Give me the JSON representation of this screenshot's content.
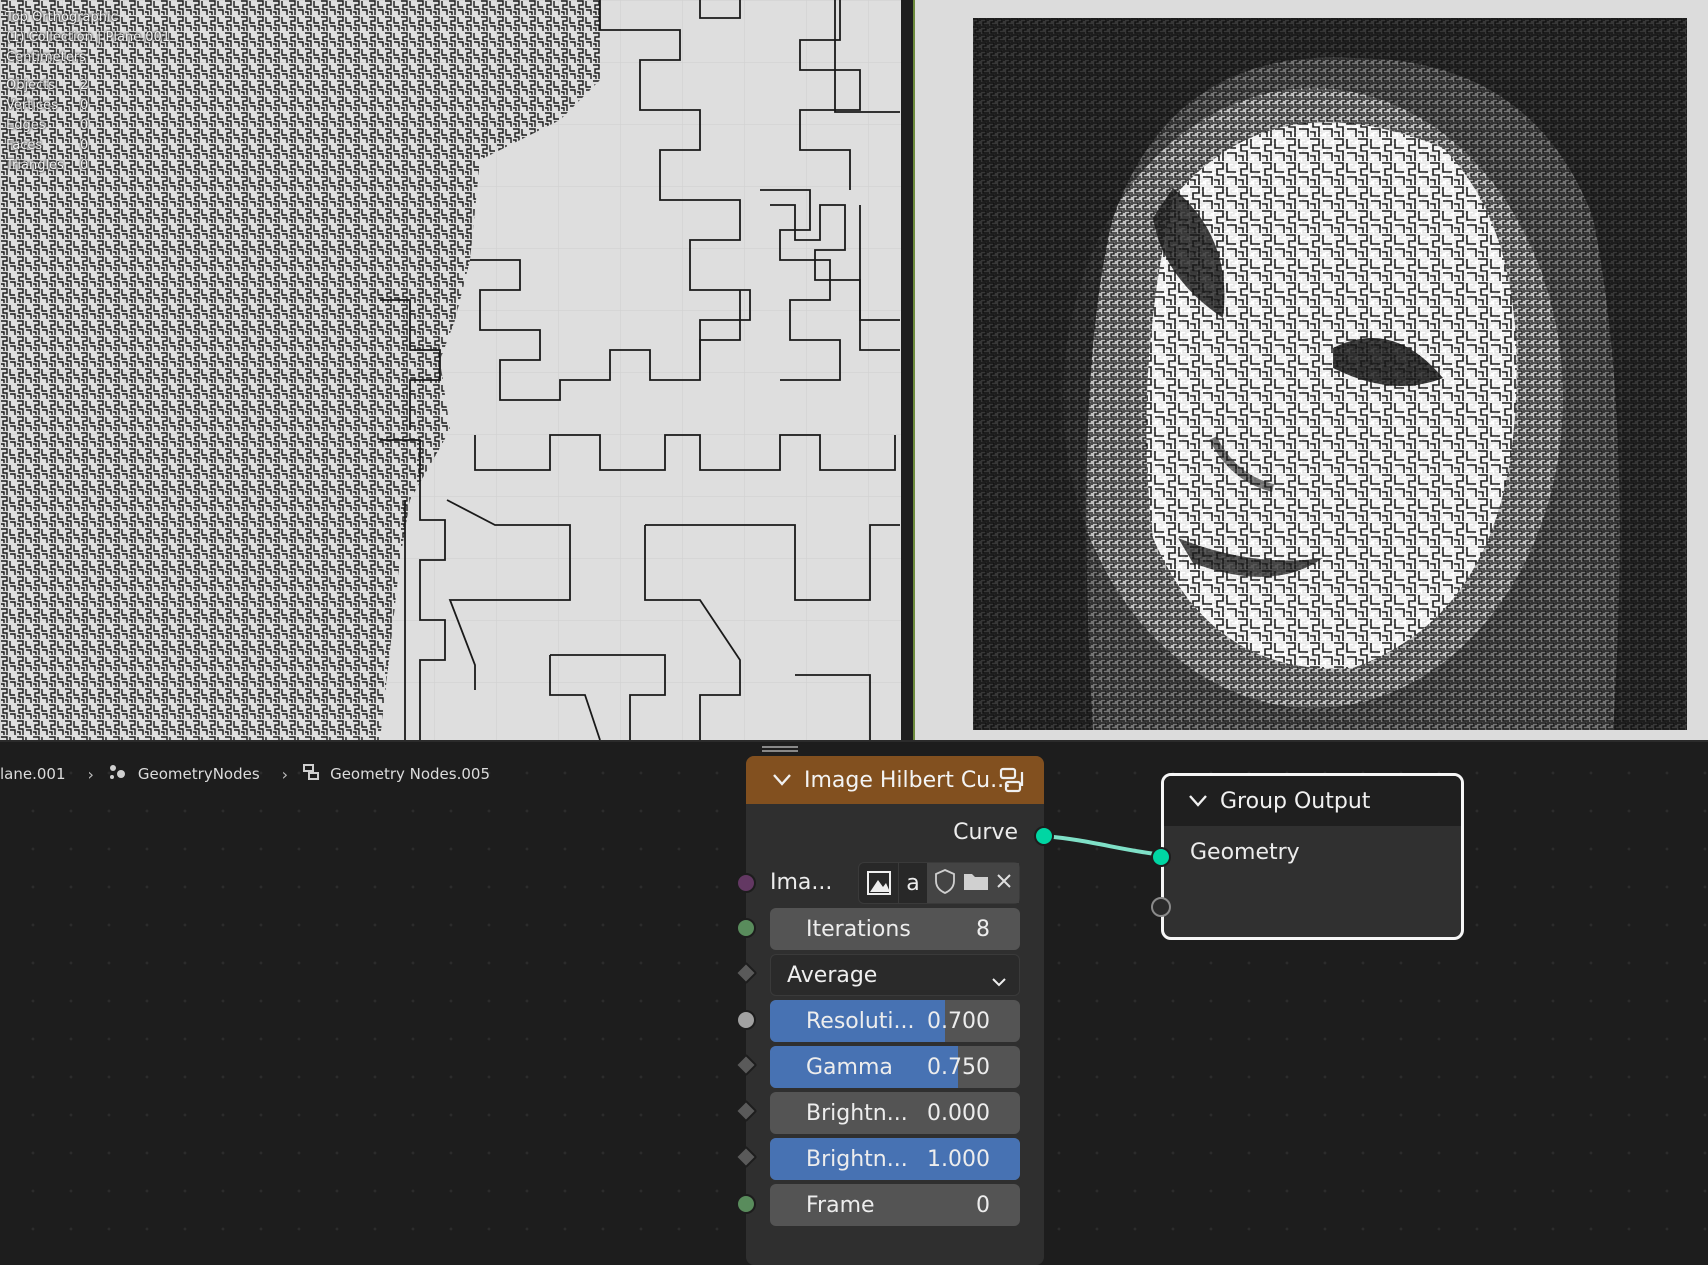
{
  "viewport": {
    "view_name": "Top Orthographic",
    "collection_path": "(1) Collection | Plane.001",
    "units": "Centimeters",
    "stats": [
      {
        "label": "Objects",
        "value": "2"
      },
      {
        "label": "Vertices",
        "value": "0"
      },
      {
        "label": "Edges",
        "value": "0"
      },
      {
        "label": "Faces",
        "value": "0"
      },
      {
        "label": "Triangles",
        "value": "0"
      }
    ]
  },
  "breadcrumb": {
    "object": "lane.001",
    "modifier": "GeometryNodes",
    "node_group": "Geometry Nodes.005"
  },
  "node_hilbert": {
    "title": "Image Hilbert Cu...",
    "output_label": "Curve",
    "image_label": "Ima...",
    "image_name": "a",
    "iterations_label": "Iterations",
    "iterations_value": "8",
    "mode_value": "Average",
    "resolution_label": "Resoluti...",
    "resolution_value": "0.700",
    "resolution_fraction": 0.7,
    "gamma_label": "Gamma",
    "gamma_value": "0.750",
    "gamma_fraction": 0.75,
    "brightness_min_label": "Brightn...",
    "brightness_min_value": "0.000",
    "brightness_min_fraction": 0.0,
    "brightness_max_label": "Brightn...",
    "brightness_max_value": "1.000",
    "brightness_max_fraction": 1.0,
    "frame_label": "Frame",
    "frame_value": "0"
  },
  "node_group_output": {
    "title": "Group Output",
    "input_label": "Geometry"
  },
  "colors": {
    "socket_geometry": "#00d6a3",
    "socket_image": "#633863",
    "socket_int": "#598c5c",
    "socket_float": "#a1a1a1",
    "slider_fill": "#4772b3",
    "node_header_group": "#82501f",
    "link": "#7fe0c7"
  }
}
